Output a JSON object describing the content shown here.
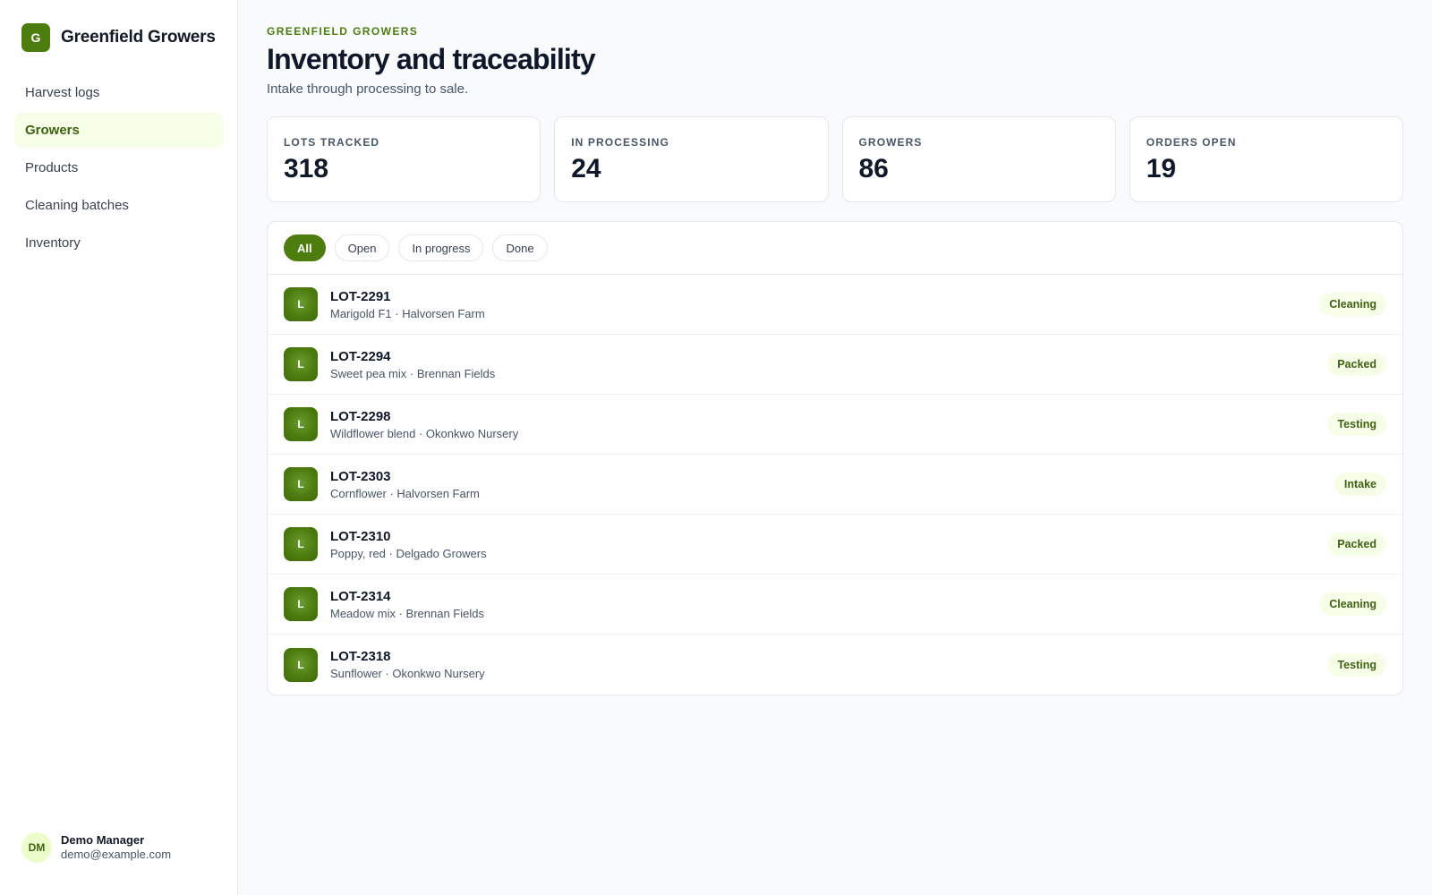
{
  "brand": {
    "logo_letter": "G",
    "name": "Greenfield Growers"
  },
  "nav": {
    "items": [
      {
        "label": "Harvest logs",
        "active": false
      },
      {
        "label": "Growers",
        "active": true
      },
      {
        "label": "Products",
        "active": false
      },
      {
        "label": "Cleaning batches",
        "active": false
      },
      {
        "label": "Inventory",
        "active": false
      }
    ]
  },
  "user": {
    "initials": "DM",
    "name": "Demo Manager",
    "email": "demo@example.com"
  },
  "header": {
    "eyebrow": "GREENFIELD GROWERS",
    "title": "Inventory and traceability",
    "subtitle": "Intake through processing to sale."
  },
  "stats": [
    {
      "label": "LOTS TRACKED",
      "value": "318"
    },
    {
      "label": "IN PROCESSING",
      "value": "24"
    },
    {
      "label": "GROWERS",
      "value": "86"
    },
    {
      "label": "ORDERS OPEN",
      "value": "19"
    }
  ],
  "filters": [
    {
      "label": "All",
      "active": true
    },
    {
      "label": "Open",
      "active": false
    },
    {
      "label": "In progress",
      "active": false
    },
    {
      "label": "Done",
      "active": false
    }
  ],
  "lots": [
    {
      "icon_letter": "L",
      "id": "LOT-2291",
      "desc": "Marigold F1 · Halvorsen Farm",
      "status": "Cleaning"
    },
    {
      "icon_letter": "L",
      "id": "LOT-2294",
      "desc": "Sweet pea mix · Brennan Fields",
      "status": "Packed"
    },
    {
      "icon_letter": "L",
      "id": "LOT-2298",
      "desc": "Wildflower blend · Okonkwo Nursery",
      "status": "Testing"
    },
    {
      "icon_letter": "L",
      "id": "LOT-2303",
      "desc": "Cornflower · Halvorsen Farm",
      "status": "Intake"
    },
    {
      "icon_letter": "L",
      "id": "LOT-2310",
      "desc": "Poppy, red · Delgado Growers",
      "status": "Packed"
    },
    {
      "icon_letter": "L",
      "id": "LOT-2314",
      "desc": "Meadow mix · Brennan Fields",
      "status": "Cleaning"
    },
    {
      "icon_letter": "L",
      "id": "LOT-2318",
      "desc": "Sunflower · Okonkwo Nursery",
      "status": "Testing"
    }
  ],
  "colors": {
    "accent": "#4d7c0f",
    "accent_soft": "#f7fee7",
    "accent_text": "#3f6212"
  }
}
